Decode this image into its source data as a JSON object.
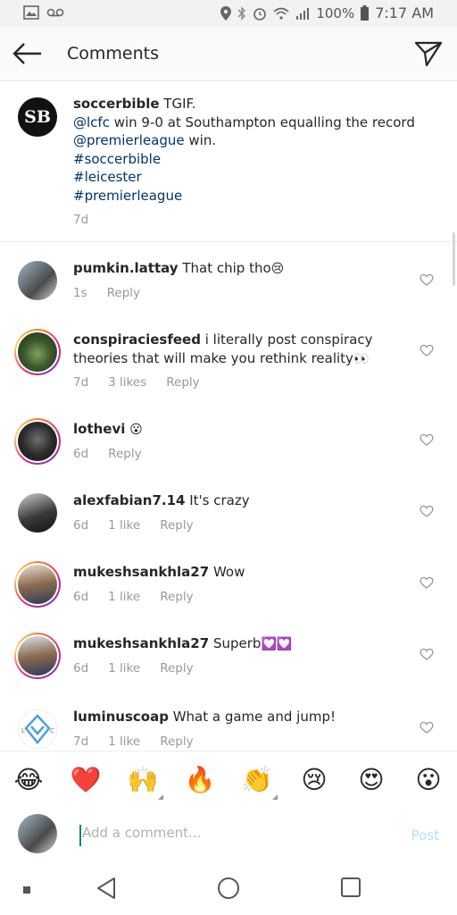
{
  "status_bar": {
    "battery": "100%",
    "time": "7:17 AM"
  },
  "header": {
    "title": "Comments"
  },
  "caption": {
    "username": "soccerbible",
    "line1": " TGIF.",
    "mention1": "@lcfc",
    "line2": " win 9-0 at Southampton equalling the record",
    "mention2": "@premierleague",
    "line3": " win.",
    "tags": [
      "#soccerbible",
      "#leicester",
      "#premierleague"
    ],
    "time": "7d",
    "avatar_text": "SB"
  },
  "comments": [
    {
      "username": "pumkin.lattay",
      "text": " That chip tho",
      "emoji": "😢",
      "time": "1s",
      "likes": "",
      "reply": "Reply"
    },
    {
      "username": "conspiraciesfeed",
      "text": " i literally post conspiracy theories that will make you rethink reality",
      "emoji": "👀",
      "time": "7d",
      "likes": "3 likes",
      "reply": "Reply"
    },
    {
      "username": "lothevi",
      "text": " ",
      "emoji": "😮",
      "time": "6d",
      "likes": "",
      "reply": "Reply"
    },
    {
      "username": "alexfabian7.14",
      "text": " It's crazy",
      "emoji": "",
      "time": "6d",
      "likes": "1 like",
      "reply": "Reply"
    },
    {
      "username": "mukeshsankhla27",
      "text": " Wow",
      "emoji": "",
      "time": "6d",
      "likes": "1 like",
      "reply": "Reply"
    },
    {
      "username": "mukeshsankhla27",
      "text": " Superb",
      "emoji": "💟💟",
      "time": "6d",
      "likes": "1 like",
      "reply": "Reply"
    },
    {
      "username": "luminuscoap",
      "text": " What a game and jump!",
      "emoji": "",
      "time": "7d",
      "likes": "1 like",
      "reply": "Reply"
    }
  ],
  "emoji_bar": [
    "😂",
    "❤️",
    "🙌",
    "🔥",
    "👏",
    "😢",
    "😍",
    "😮"
  ],
  "compose": {
    "placeholder": "Add a comment...",
    "post_label": "Post"
  },
  "colors": {
    "link": "#003569",
    "meta": "#999999",
    "post_disabled": "#b2dffc"
  }
}
